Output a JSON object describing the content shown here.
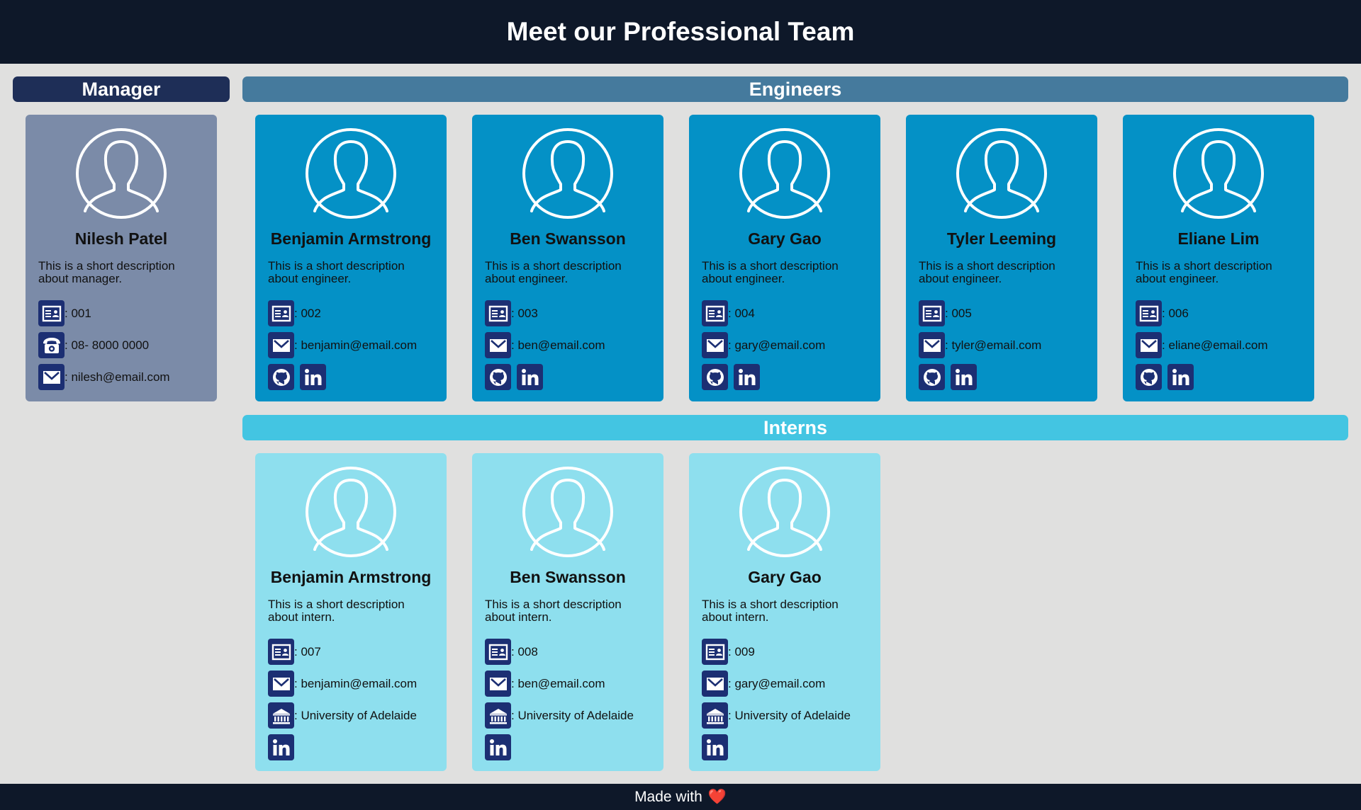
{
  "page_title": "Meet our Professional Team",
  "footer": {
    "text": "Made with",
    "heart": "❤️"
  },
  "colors": {
    "header_bg": "#0e1829",
    "manager_bar": "#1e2e57",
    "engineers_bar": "#457a9d",
    "interns_bar": "#43c5e2",
    "manager_card": "#7b8ba8",
    "engineer_card": "#0491c6",
    "intern_card": "#8edfee",
    "icon_bg": "#1c2f73"
  },
  "sections": {
    "manager": "Manager",
    "engineers": "Engineers",
    "interns": "Interns"
  },
  "manager": {
    "name": "Nilesh Patel",
    "desc": "This is a short description about manager.",
    "id": ": 001",
    "phone": ": 08- 8000 0000",
    "email": ": nilesh@email.com"
  },
  "engineers": [
    {
      "name": "Benjamin Armstrong",
      "desc": "This is a short description about engineer.",
      "id": ": 002",
      "email": ": benjamin@email.com"
    },
    {
      "name": "Ben Swansson",
      "desc": "This is a short description about engineer.",
      "id": ": 003",
      "email": ": ben@email.com"
    },
    {
      "name": "Gary Gao",
      "desc": "This is a short description about engineer.",
      "id": ": 004",
      "email": ": gary@email.com"
    },
    {
      "name": "Tyler Leeming",
      "desc": "This is a short description about engineer.",
      "id": ": 005",
      "email": ": tyler@email.com"
    },
    {
      "name": "Eliane Lim",
      "desc": "This is a short description about engineer.",
      "id": ": 006",
      "email": ": eliane@email.com"
    }
  ],
  "interns": [
    {
      "name": "Benjamin Armstrong",
      "desc": "This is a short description about intern.",
      "id": ": 007",
      "email": ": benjamin@email.com",
      "school": ": University of Adelaide"
    },
    {
      "name": "Ben Swansson",
      "desc": "This is a short description about intern.",
      "id": ": 008",
      "email": ": ben@email.com",
      "school": ": University of Adelaide"
    },
    {
      "name": "Gary Gao",
      "desc": "This is a short description about intern.",
      "id": ": 009",
      "email": ": gary@email.com",
      "school": ": University of Adelaide"
    }
  ]
}
